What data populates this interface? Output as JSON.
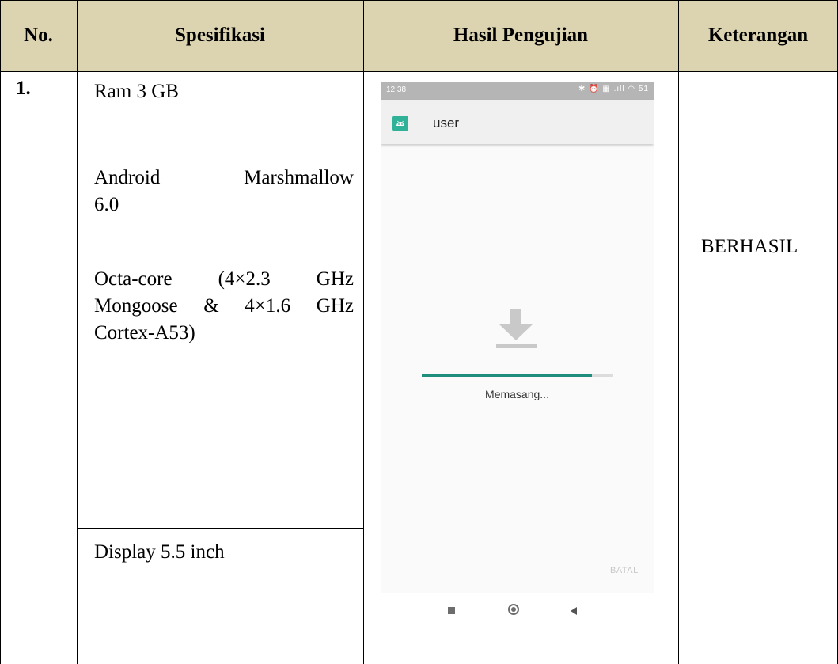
{
  "table": {
    "headers": [
      "No.",
      "Spesifikasi",
      "Hasil Pengujian",
      "Keterangan"
    ],
    "row": {
      "no": "1.",
      "specs": [
        [
          "Ram 3 GB"
        ],
        [
          "Android Marshmallow",
          "6.0"
        ],
        [
          "Octa-core (4×2.3 GHz",
          "Mongoose & 4×1.6 GHz",
          "Cortex-A53)"
        ],
        [
          "Display 5.5 inch"
        ]
      ],
      "keterangan": "BERHASIL"
    }
  },
  "phone": {
    "status_time": "12:38",
    "status_icons": "✱ ⏰ ▦ .ıll ◠ 51",
    "app_title": "user",
    "progress_label": "Memasang...",
    "progress_fraction": 0.89,
    "cancel_label": "BATAL",
    "colors": {
      "accent": "#1f8f7d",
      "app_icon": "#2fb297",
      "header_fill": "#dcd3b1"
    },
    "icons": [
      "android-app-icon",
      "download-icon",
      "nav-recents-icon",
      "nav-home-icon",
      "nav-back-icon"
    ]
  }
}
